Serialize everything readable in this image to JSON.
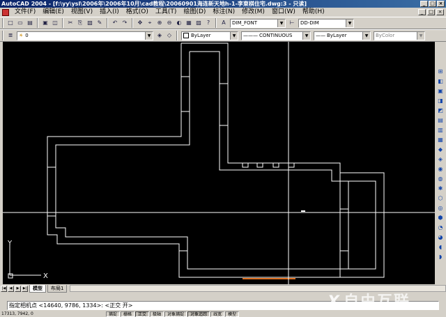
{
  "window": {
    "title": "AutoCAD 2004 - [f:\\yy\\ysl\\2006年\\2006年10月\\cad教程\\20060901海连新天地h-1-李東棋住宅.dwg:3 - 只读]",
    "buttons": [
      "_",
      "□",
      "×"
    ]
  },
  "menu": {
    "items": [
      "文件(F)",
      "编辑(E)",
      "视图(V)",
      "插入(I)",
      "格式(O)",
      "工具(T)",
      "绘图(D)",
      "标注(N)",
      "修改(M)",
      "窗口(W)",
      "帮助(H)"
    ],
    "doc_buttons": [
      "_",
      "□",
      "×"
    ]
  },
  "toolbar1": {
    "buttons": [
      "□",
      "▭",
      "▤",
      "▣",
      "◫",
      "✂",
      "⎘",
      "▧",
      "✎",
      "↶",
      "↷",
      "✥",
      "⌖",
      "⊕",
      "⊖",
      "◐",
      "▦",
      "▨",
      "?"
    ],
    "text_style": "DIM_FONT",
    "dim_style": "DD-DIM"
  },
  "toolbar2": {
    "layer_value": "0",
    "color_value": "ByLayer",
    "linetype_value": "CONTINUOUS",
    "lineweight_value": "ByLayer",
    "plotstyle_value": "ByColor"
  },
  "right_toolbar": {
    "icons": [
      "⊞",
      "◧",
      "▣",
      "◨",
      "◩",
      "▤",
      "▥",
      "▦",
      "◆",
      "◈",
      "◉",
      "◍",
      "✱",
      "⬡",
      "◎",
      "⬢",
      "◔",
      "◕",
      "◖",
      "◗"
    ]
  },
  "canvas": {
    "background": "#000000",
    "line_color": "#ffffff",
    "ucs_x": "X",
    "ucs_y": "Y"
  },
  "tabs": {
    "nav": [
      "|◀",
      "◀",
      "▶",
      "▶|"
    ],
    "items": [
      "模型",
      "布局1"
    ],
    "active": "模型"
  },
  "command": {
    "text": "指定相机点 <14640, 9786, 1334>:  <正交 开>"
  },
  "status": {
    "coords": "17313, 7942, 0",
    "buttons": [
      "捕捉",
      "栅格",
      "正交",
      "极轴",
      "对象捕捉",
      "对象追踪",
      "线宽",
      "模型"
    ],
    "on_states": [
      false,
      false,
      true,
      false,
      false,
      true,
      false,
      false
    ]
  },
  "watermark": {
    "mark": "X",
    "text": "自由互联"
  }
}
